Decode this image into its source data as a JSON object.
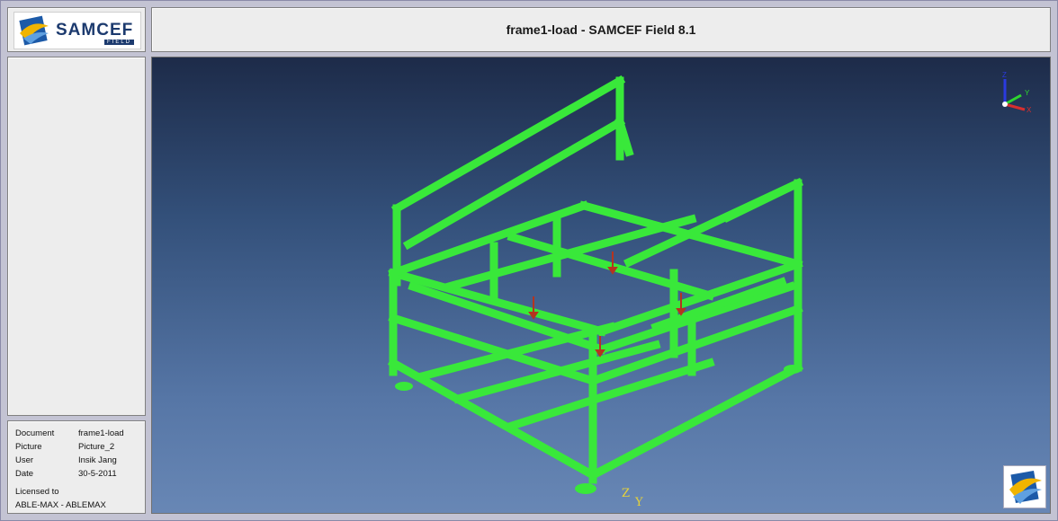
{
  "app": {
    "title": "frame1-load - SAMCEF Field 8.1",
    "logo_text": "SAMCEF",
    "logo_sub": "FIELD"
  },
  "info": {
    "rows": [
      {
        "key": "Document",
        "value": "frame1-load"
      },
      {
        "key": "Picture",
        "value": "Picture_2"
      },
      {
        "key": "User",
        "value": "Insik Jang"
      },
      {
        "key": "Date",
        "value": "30-5-2011"
      }
    ],
    "licensed_label": "Licensed to",
    "licensed_value": "ABLE-MAX - ABLEMAX"
  },
  "viewport": {
    "triad_labels": {
      "z": "Z",
      "y": "Y",
      "x": "X"
    },
    "bottom_axis": {
      "z": "Z",
      "y": "Y"
    },
    "mesh_color": "#39e83a",
    "load_color": "#b5341f"
  },
  "icons": {
    "brand_logo": "samcef-logo",
    "corner_logo": "samcef-swirl-icon"
  }
}
